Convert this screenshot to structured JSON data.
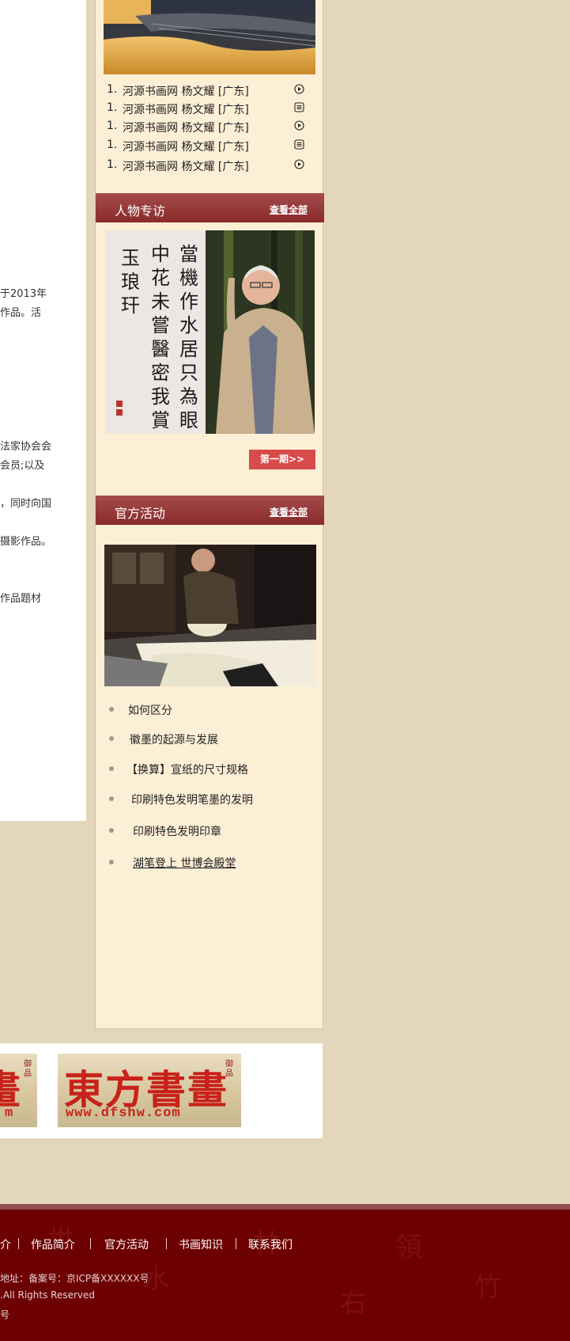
{
  "left_article": {
    "fragments": [
      "于2013年",
      "作品。活",
      "法家协会会",
      "会员;以及",
      "，同时向国",
      "摄影作品。",
      "作品题材"
    ]
  },
  "video_list": {
    "items": [
      {
        "num": "1.",
        "text": "河源书画网 杨文耀 [广东]",
        "icon": "play-circle-icon"
      },
      {
        "num": "1.",
        "text": "河源书画网 杨文耀 [广东]",
        "icon": "document-icon"
      },
      {
        "num": "1.",
        "text": "河源书画网 杨文耀 [广东]",
        "icon": "play-circle-icon"
      },
      {
        "num": "1.",
        "text": "河源书画网 杨文耀 [广东]",
        "icon": "document-icon"
      },
      {
        "num": "1.",
        "text": "河源书画网 杨文耀 [广东]",
        "icon": "play-circle-icon"
      }
    ]
  },
  "interview": {
    "title": "人物专访",
    "more": "查看全部",
    "calligraphy_lines": [
      "當機作水居只為眼",
      "中花未嘗醫密我賞",
      "玉琅玕"
    ],
    "issue_button": "第一期>>"
  },
  "activities": {
    "title": "官方活动",
    "more": "查看全部",
    "items": [
      "如何区分",
      "徽墨的起源与发展",
      "【换算】宣纸的尺寸规格",
      "印刷特色发明笔墨的发明",
      "印刷特色发明印章",
      "湖笔登上 世博会殿堂"
    ]
  },
  "banners": {
    "left_fragment": "畫",
    "left_url_fragment": "m",
    "main_title": "東方書畫",
    "main_url": "www.dfshw.com"
  },
  "footer": {
    "nav": [
      "介",
      "作品简介",
      "官方活动",
      "书画知识",
      "联系我们"
    ],
    "lines": [
      "地址：备案号：京ICP备XXXXXX号",
      ".All Rights Reserved",
      "号"
    ]
  },
  "colors": {
    "page_bg": "#e4d6bb",
    "sidebar_bg": "#fcefd6",
    "section_header": "#8a2a2a",
    "button_red": "#d84b4b",
    "footer_bg": "#6d0000"
  }
}
